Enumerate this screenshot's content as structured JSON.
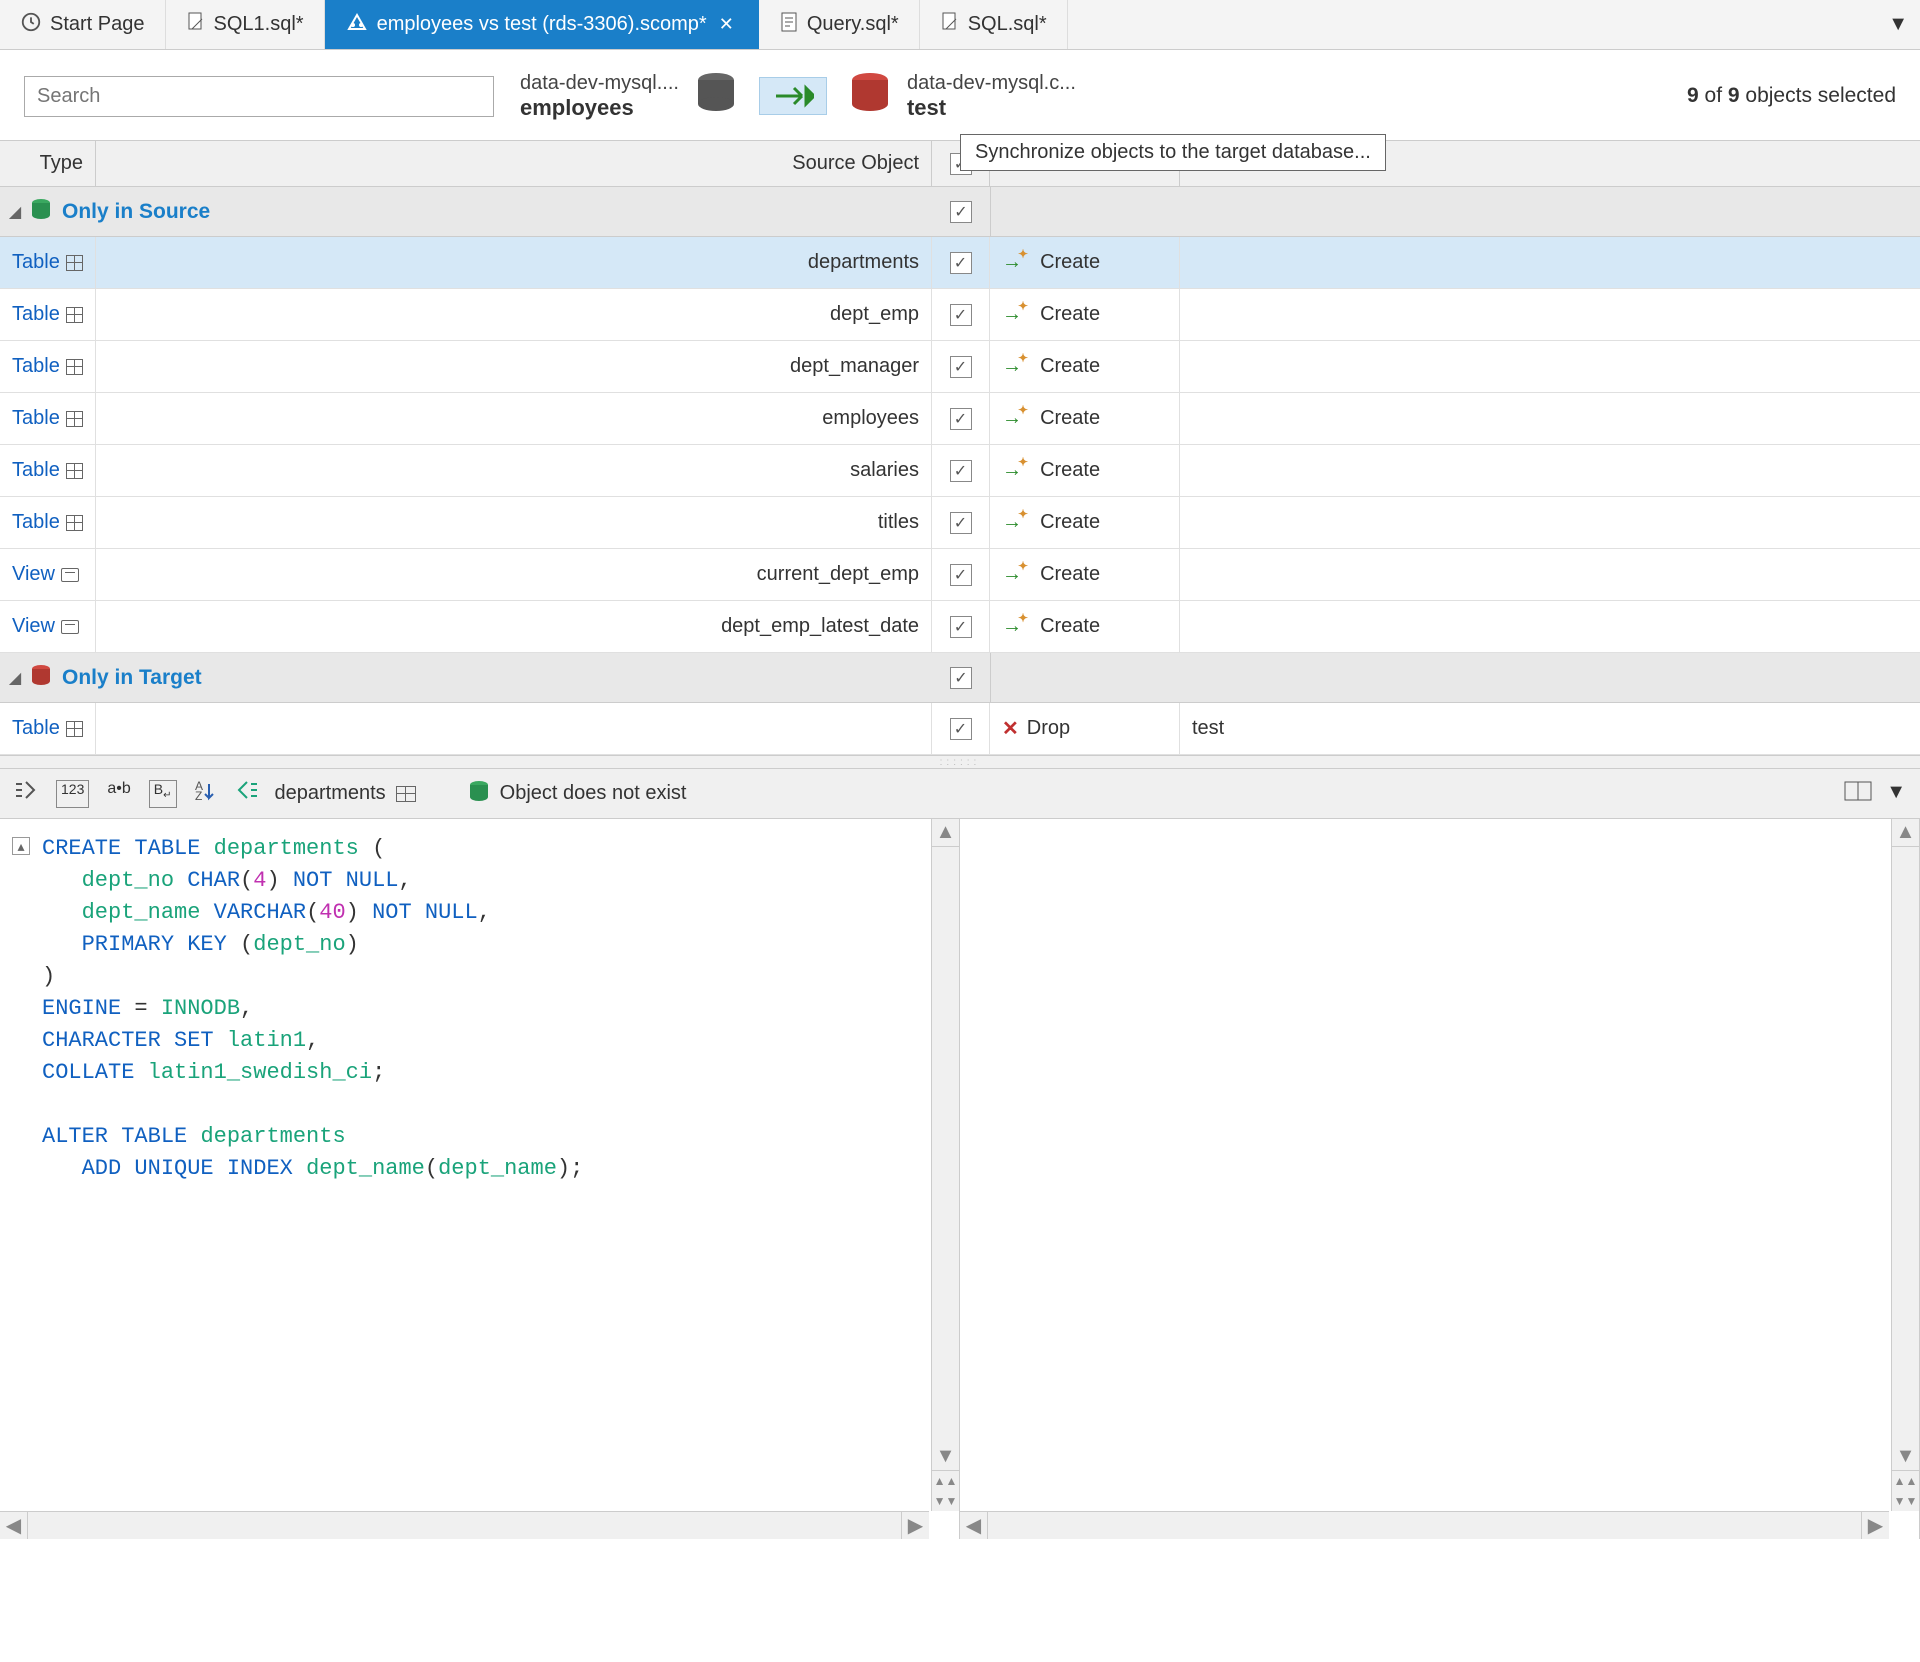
{
  "tabs": [
    {
      "label": "Start Page"
    },
    {
      "label": "SQL1.sql*"
    },
    {
      "label": "employees vs test (rds-3306).scomp*",
      "active": true
    },
    {
      "label": "Query.sql*"
    },
    {
      "label": "SQL.sql*"
    }
  ],
  "search": {
    "placeholder": "Search"
  },
  "source": {
    "host": "data-dev-mysql....",
    "db": "employees"
  },
  "target": {
    "host": "data-dev-mysql.c...",
    "db": "test"
  },
  "status": {
    "selected": "9",
    "total": "9",
    "suffix": "objects selected"
  },
  "tooltip": "Synchronize objects to the target database...",
  "columns": {
    "type": "Type",
    "source": "Source Object"
  },
  "groups": {
    "source": {
      "label": "Only in Source"
    },
    "target": {
      "label": "Only in Target"
    }
  },
  "rowsSource": [
    {
      "type": "Table",
      "icon": "table",
      "name": "departments",
      "action": "Create",
      "selected": true
    },
    {
      "type": "Table",
      "icon": "table",
      "name": "dept_emp",
      "action": "Create"
    },
    {
      "type": "Table",
      "icon": "table",
      "name": "dept_manager",
      "action": "Create"
    },
    {
      "type": "Table",
      "icon": "table",
      "name": "employees",
      "action": "Create"
    },
    {
      "type": "Table",
      "icon": "table",
      "name": "salaries",
      "action": "Create"
    },
    {
      "type": "Table",
      "icon": "table",
      "name": "titles",
      "action": "Create"
    },
    {
      "type": "View",
      "icon": "view",
      "name": "current_dept_emp",
      "action": "Create"
    },
    {
      "type": "View",
      "icon": "view",
      "name": "dept_emp_latest_date",
      "action": "Create"
    }
  ],
  "rowsTarget": [
    {
      "type": "Table",
      "icon": "table",
      "name": "",
      "action": "Drop",
      "target": "test"
    }
  ],
  "editor": {
    "left_object": "departments",
    "right_status": "Object does not exist",
    "sql": "CREATE TABLE departments (\n   dept_no CHAR(4) NOT NULL,\n   dept_name VARCHAR(40) NOT NULL,\n   PRIMARY KEY (dept_no)\n)\nENGINE = INNODB,\nCHARACTER SET latin1,\nCOLLATE latin1_swedish_ci;\n\nALTER TABLE departments\n   ADD UNIQUE INDEX dept_name(dept_name);"
  }
}
